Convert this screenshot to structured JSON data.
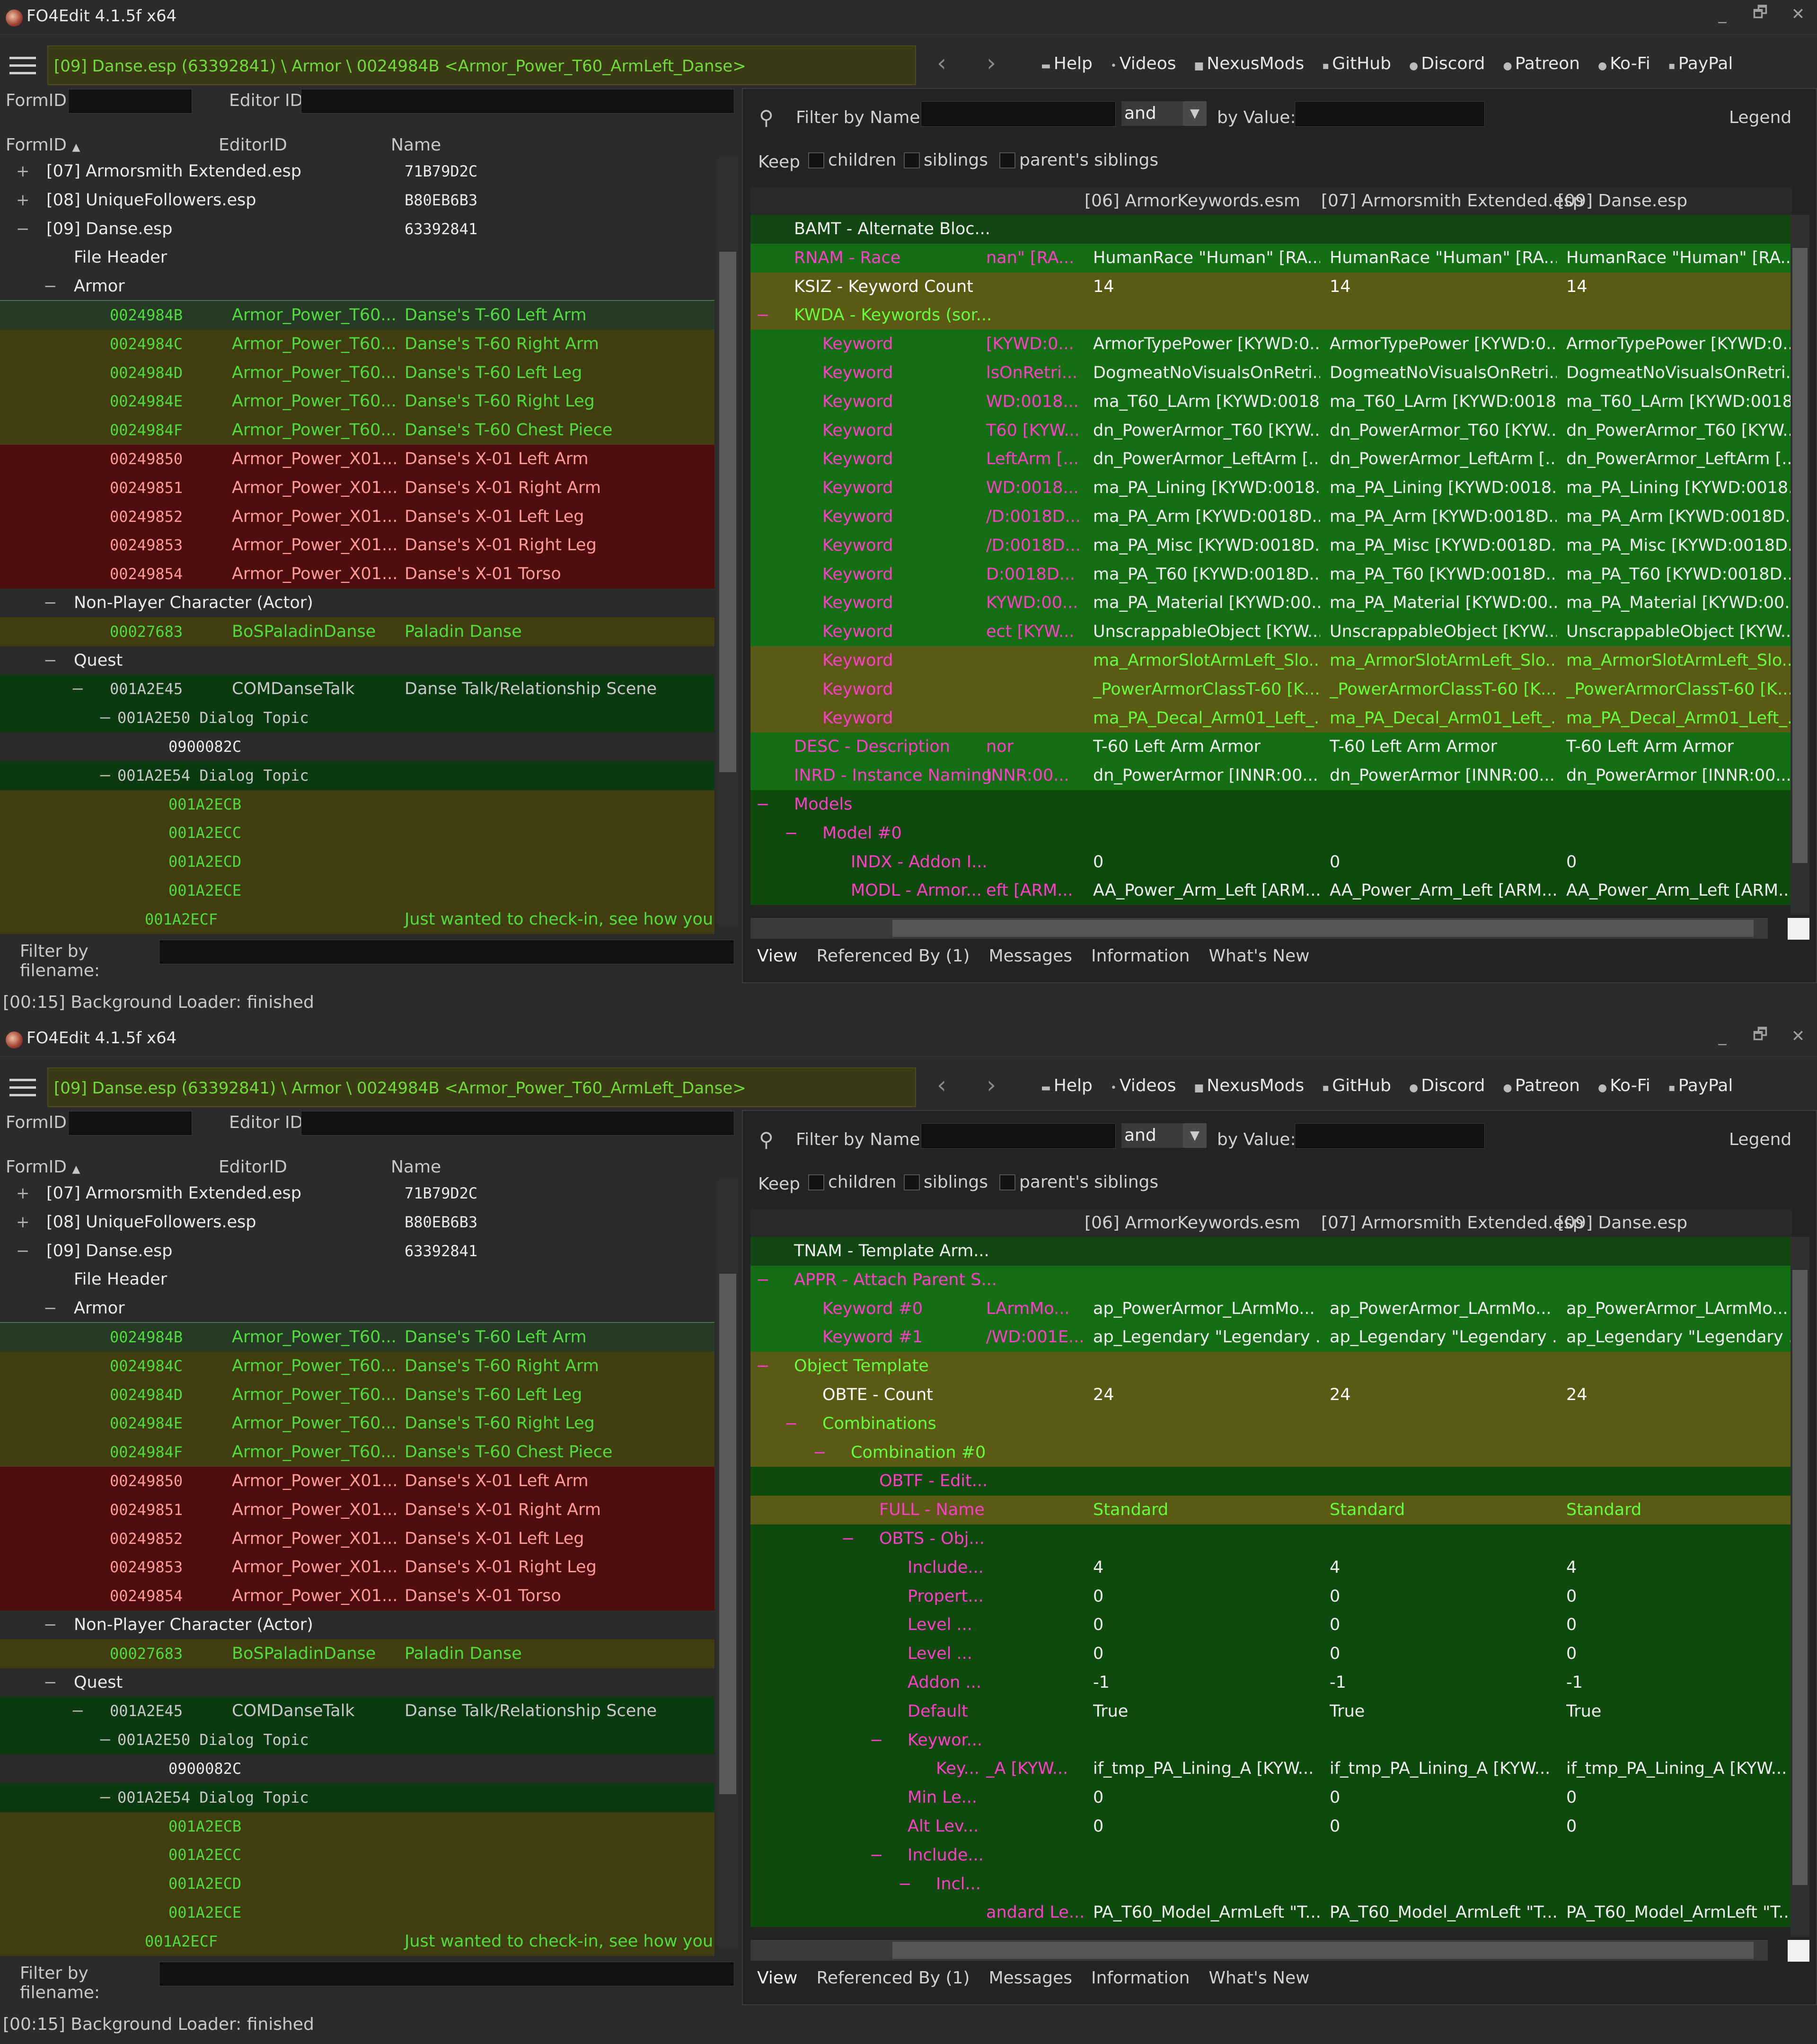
{
  "app_title": "FO4Edit 4.1.5f x64",
  "window_controls": [
    "_",
    "🗗",
    "✕"
  ],
  "path": "[09] Danse.esp (63392841) \\ Armor \\ 0024984B <Armor_Power_T60_ArmLeft_Danse>",
  "nav": {
    "back": "‹",
    "forward": "›"
  },
  "links": [
    {
      "icon": "▬",
      "label": "Help"
    },
    {
      "icon": "•",
      "label": "Videos"
    },
    {
      "icon": "■",
      "label": "NexusMods"
    },
    {
      "icon": "▪",
      "label": "GitHub"
    },
    {
      "icon": "●",
      "label": "Discord"
    },
    {
      "icon": "●",
      "label": "Patreon"
    },
    {
      "icon": "●",
      "label": "Ko-Fi"
    },
    {
      "icon": "▪",
      "label": "PayPal"
    }
  ],
  "formid_label": "FormID",
  "editorid_label": "Editor ID",
  "tree_headers": {
    "formid": "FormID",
    "editorid": "EditorID",
    "name": "Name"
  },
  "tree_rows": [
    {
      "ind": 0,
      "exp": "+",
      "c1": "[07] Armorsmith Extended.esp",
      "c2": "",
      "c3": "71B79D2C",
      "bg": "bg-none",
      "cls": "t-wht",
      "mono3": true
    },
    {
      "ind": 0,
      "exp": "+",
      "c1": "[08] UniqueFollowers.esp",
      "c2": "",
      "c3": "B80EB6B3",
      "bg": "bg-none",
      "cls": "t-wht",
      "mono3": true
    },
    {
      "ind": 0,
      "exp": "−",
      "c1": "[09] Danse.esp",
      "c2": "",
      "c3": "63392841",
      "bg": "bg-none",
      "cls": "t-wht",
      "mono3": true
    },
    {
      "ind": 1,
      "exp": "",
      "c1": "File Header",
      "c2": "",
      "c3": "",
      "bg": "bg-none",
      "cls": "t-wht"
    },
    {
      "ind": 1,
      "exp": "−",
      "c1": "Armor",
      "c2": "",
      "c3": "",
      "bg": "bg-none",
      "cls": "t-wht"
    },
    {
      "ind": 2,
      "exp": "",
      "c1": "0024984B",
      "c2": "Armor_Power_T60...",
      "c3": "Danse's T-60 Left Arm",
      "bg": "bg-sel",
      "cls": "t-grn",
      "mono1": true
    },
    {
      "ind": 2,
      "exp": "",
      "c1": "0024984C",
      "c2": "Armor_Power_T60...",
      "c3": "Danse's T-60 Right Arm",
      "bg": "bg-ylw",
      "cls": "t-grn",
      "mono1": true
    },
    {
      "ind": 2,
      "exp": "",
      "c1": "0024984D",
      "c2": "Armor_Power_T60...",
      "c3": "Danse's T-60 Left Leg",
      "bg": "bg-ylw",
      "cls": "t-grn",
      "mono1": true
    },
    {
      "ind": 2,
      "exp": "",
      "c1": "0024984E",
      "c2": "Armor_Power_T60...",
      "c3": "Danse's T-60 Right Leg",
      "bg": "bg-ylw",
      "cls": "t-grn",
      "mono1": true
    },
    {
      "ind": 2,
      "exp": "",
      "c1": "0024984F",
      "c2": "Armor_Power_T60...",
      "c3": "Danse's T-60 Chest Piece",
      "bg": "bg-ylw",
      "cls": "t-grn",
      "mono1": true
    },
    {
      "ind": 2,
      "exp": "",
      "c1": "00249850",
      "c2": "Armor_Power_X01...",
      "c3": "Danse's X-01 Left Arm",
      "bg": "bg-red",
      "cls": "t-pnk",
      "mono1": true
    },
    {
      "ind": 2,
      "exp": "",
      "c1": "00249851",
      "c2": "Armor_Power_X01...",
      "c3": "Danse's X-01 Right Arm",
      "bg": "bg-red",
      "cls": "t-pnk",
      "mono1": true
    },
    {
      "ind": 2,
      "exp": "",
      "c1": "00249852",
      "c2": "Armor_Power_X01...",
      "c3": "Danse's X-01 Left Leg",
      "bg": "bg-red",
      "cls": "t-pnk",
      "mono1": true
    },
    {
      "ind": 2,
      "exp": "",
      "c1": "00249853",
      "c2": "Armor_Power_X01...",
      "c3": "Danse's X-01 Right Leg",
      "bg": "bg-red",
      "cls": "t-pnk",
      "mono1": true
    },
    {
      "ind": 2,
      "exp": "",
      "c1": "00249854",
      "c2": "Armor_Power_X01...",
      "c3": "Danse's X-01 Torso",
      "bg": "bg-red",
      "cls": "t-pnk",
      "mono1": true
    },
    {
      "ind": 1,
      "exp": "−",
      "c1": "Non-Player Character (Actor)",
      "c2": "",
      "c3": "",
      "bg": "bg-none",
      "cls": "t-wht"
    },
    {
      "ind": 2,
      "exp": "",
      "c1": "00027683",
      "c2": "BoSPaladinDanse",
      "c3": "Paladin Danse",
      "bg": "bg-ylw",
      "cls": "t-grn",
      "mono1": true
    },
    {
      "ind": 1,
      "exp": "−",
      "c1": "Quest",
      "c2": "",
      "c3": "",
      "bg": "bg-none",
      "cls": "t-wht"
    },
    {
      "ind": 2,
      "exp": "−",
      "c1": "001A2E45",
      "c2": "COMDanseTalk",
      "c3": "Danse Talk/Relationship Scene",
      "bg": "bg-grn",
      "cls": "t-gry",
      "mono1": true
    },
    {
      "ind": 3,
      "exp": "−",
      "c1": "001A2E50  Dialog Topic",
      "c2": "",
      "c3": "",
      "bg": "bg-grn",
      "cls": "t-gry",
      "mono1": true
    },
    {
      "ind": 4,
      "exp": "",
      "c1": "0900082C",
      "c2": "",
      "c3": "",
      "bg": "bg-none",
      "cls": "t-wht",
      "mono1": true
    },
    {
      "ind": 3,
      "exp": "−",
      "c1": "001A2E54  Dialog Topic",
      "c2": "",
      "c3": "",
      "bg": "bg-grn",
      "cls": "t-gry",
      "mono1": true
    },
    {
      "ind": 4,
      "exp": "",
      "c1": "001A2ECB",
      "c2": "",
      "c3": "",
      "bg": "bg-ylw",
      "cls": "t-grn",
      "mono1": true
    },
    {
      "ind": 4,
      "exp": "",
      "c1": "001A2ECC",
      "c2": "",
      "c3": "",
      "bg": "bg-ylw",
      "cls": "t-grn",
      "mono1": true
    },
    {
      "ind": 4,
      "exp": "",
      "c1": "001A2ECD",
      "c2": "",
      "c3": "",
      "bg": "bg-ylw",
      "cls": "t-grn",
      "mono1": true
    },
    {
      "ind": 4,
      "exp": "",
      "c1": "001A2ECE",
      "c2": "",
      "c3": "",
      "bg": "bg-ylw",
      "cls": "t-grn",
      "mono1": true
    },
    {
      "ind": 4,
      "exp": "",
      "c1": "001A2ECF",
      "c2": "",
      "c3": "Just wanted to check-in, see how you f...",
      "bg": "bg-ylw",
      "cls": "t-grn",
      "mono1": true
    }
  ],
  "filter_filename_label": "Filter by filename:",
  "status_text": "[00:15] Background Loader: finished",
  "right": {
    "filter_by_name": "Filter by Name:",
    "and": "and",
    "by_value": "by Value:",
    "legend": "Legend",
    "keep": "Keep",
    "children": "children",
    "siblings": "siblings",
    "parent_siblings": "parent's siblings",
    "col_a": "[06] ArmorKeywords.esm",
    "col_b": "[07] Armorsmith Extended.esp",
    "col_c": "[09] Danse.esp",
    "tabs": [
      "View",
      "Referenced By (1)",
      "Messages",
      "Information",
      "What's New"
    ]
  },
  "grid_top": [
    {
      "ind": 0,
      "exp": "",
      "a": "BAMT - Alternate Bloc...",
      "b": "",
      "c": "",
      "d": "",
      "e": "",
      "bg": "bg-hdr",
      "ac": "v-wht",
      "vc": "v-wht"
    },
    {
      "ind": 0,
      "exp": "",
      "a": "RNAM - Race",
      "b": "nan\" [RA...",
      "c": "HumanRace \"Human\" [RA...",
      "d": "HumanRace \"Human\" [RA...",
      "e": "HumanRace \"Human\" [RA...",
      "bg": "bg-lime",
      "ac": "",
      "vc": "v-wht"
    },
    {
      "ind": 0,
      "exp": "",
      "a": "KSIZ - Keyword Count",
      "b": "",
      "c": "14",
      "d": "14",
      "e": "14",
      "bg": "bg-olive",
      "ac": "v-w2",
      "vc": "v-w2"
    },
    {
      "ind": 0,
      "exp": "−",
      "a": "KWDA - Keywords (sor...",
      "b": "",
      "c": "",
      "d": "",
      "e": "",
      "bg": "bg-olive",
      "ac": "v-lim",
      "vc": "v-wht"
    },
    {
      "ind": 1,
      "exp": "",
      "a": "Keyword",
      "b": " [KYWD:0...",
      "c": "ArmorTypePower [KYWD:0...",
      "d": "ArmorTypePower [KYWD:0...",
      "e": "ArmorTypePower [KYWD:0...",
      "bg": "bg-lime",
      "ac": "",
      "vc": "v-wht"
    },
    {
      "ind": 1,
      "exp": "",
      "a": "Keyword",
      "b": "lsOnRetri...",
      "c": "DogmeatNoVisualsOnRetri...",
      "d": "DogmeatNoVisualsOnRetri...",
      "e": "DogmeatNoVisualsOnRetri...",
      "bg": "bg-lime",
      "ac": "",
      "vc": "v-wht"
    },
    {
      "ind": 1,
      "exp": "",
      "a": "Keyword",
      "b": "WD:0018...",
      "c": "ma_T60_LArm [KYWD:0018...",
      "d": "ma_T60_LArm [KYWD:0018...",
      "e": "ma_T60_LArm [KYWD:0018...",
      "bg": "bg-lime",
      "ac": "",
      "vc": "v-wht"
    },
    {
      "ind": 1,
      "exp": "",
      "a": "Keyword",
      "b": "T60 [KYW...",
      "c": "dn_PowerArmor_T60 [KYW...",
      "d": "dn_PowerArmor_T60 [KYW...",
      "e": "dn_PowerArmor_T60 [KYW...",
      "bg": "bg-lime",
      "ac": "",
      "vc": "v-wht"
    },
    {
      "ind": 1,
      "exp": "",
      "a": "Keyword",
      "b": "LeftArm [...",
      "c": "dn_PowerArmor_LeftArm [...",
      "d": "dn_PowerArmor_LeftArm [...",
      "e": "dn_PowerArmor_LeftArm [...",
      "bg": "bg-lime",
      "ac": "",
      "vc": "v-wht"
    },
    {
      "ind": 1,
      "exp": "",
      "a": "Keyword",
      "b": "WD:0018...",
      "c": "ma_PA_Lining [KYWD:0018...",
      "d": "ma_PA_Lining [KYWD:0018...",
      "e": "ma_PA_Lining [KYWD:0018...",
      "bg": "bg-lime",
      "ac": "",
      "vc": "v-wht"
    },
    {
      "ind": 1,
      "exp": "",
      "a": "Keyword",
      "b": "/D:0018D...",
      "c": "ma_PA_Arm [KYWD:0018D...",
      "d": "ma_PA_Arm [KYWD:0018D...",
      "e": "ma_PA_Arm [KYWD:0018D...",
      "bg": "bg-lime",
      "ac": "",
      "vc": "v-wht"
    },
    {
      "ind": 1,
      "exp": "",
      "a": "Keyword",
      "b": "/D:0018D...",
      "c": "ma_PA_Misc [KYWD:0018D...",
      "d": "ma_PA_Misc [KYWD:0018D...",
      "e": "ma_PA_Misc [KYWD:0018D...",
      "bg": "bg-lime",
      "ac": "",
      "vc": "v-wht"
    },
    {
      "ind": 1,
      "exp": "",
      "a": "Keyword",
      "b": "D:0018D...",
      "c": "ma_PA_T60 [KYWD:0018D...",
      "d": "ma_PA_T60 [KYWD:0018D...",
      "e": "ma_PA_T60 [KYWD:0018D...",
      "bg": "bg-lime",
      "ac": "",
      "vc": "v-wht"
    },
    {
      "ind": 1,
      "exp": "",
      "a": "Keyword",
      "b": "KYWD:00...",
      "c": "ma_PA_Material [KYWD:00...",
      "d": "ma_PA_Material [KYWD:00...",
      "e": "ma_PA_Material [KYWD:00...",
      "bg": "bg-lime",
      "ac": "",
      "vc": "v-wht"
    },
    {
      "ind": 1,
      "exp": "",
      "a": "Keyword",
      "b": "ect [KYW...",
      "c": "UnscrappableObject [KYW...",
      "d": "UnscrappableObject [KYW...",
      "e": "UnscrappableObject [KYW...",
      "bg": "bg-lime",
      "ac": "",
      "vc": "v-wht"
    },
    {
      "ind": 1,
      "exp": "",
      "a": "Keyword",
      "b": "",
      "c": "ma_ArmorSlotArmLeft_Slo...",
      "d": "ma_ArmorSlotArmLeft_Slo...",
      "e": "ma_ArmorSlotArmLeft_Slo...",
      "bg": "bg-olive",
      "ac": "",
      "vc": "v-lim"
    },
    {
      "ind": 1,
      "exp": "",
      "a": "Keyword",
      "b": "",
      "c": "_PowerArmorClassT-60 [K...",
      "d": "_PowerArmorClassT-60 [K...",
      "e": "_PowerArmorClassT-60 [K...",
      "bg": "bg-olive",
      "ac": "",
      "vc": "v-lim"
    },
    {
      "ind": 1,
      "exp": "",
      "a": "Keyword",
      "b": "",
      "c": "ma_PA_Decal_Arm01_Left_...",
      "d": "ma_PA_Decal_Arm01_Left_...",
      "e": "ma_PA_Decal_Arm01_Left_...",
      "bg": "bg-olive",
      "ac": "",
      "vc": "v-lim"
    },
    {
      "ind": 0,
      "exp": "",
      "a": "DESC - Description",
      "b": "nor",
      "c": "T-60 Left Arm Armor",
      "d": "T-60 Left Arm Armor",
      "e": "T-60 Left Arm Armor",
      "bg": "bg-lime",
      "ac": "",
      "vc": "v-wht"
    },
    {
      "ind": 0,
      "exp": "",
      "a": "INRD - Instance Naming",
      "b": "INNR:00...",
      "c": "dn_PowerArmor [INNR:00...",
      "d": "dn_PowerArmor [INNR:00...",
      "e": "dn_PowerArmor [INNR:00...",
      "bg": "bg-lime",
      "ac": "",
      "vc": "v-wht"
    },
    {
      "ind": 0,
      "exp": "−",
      "a": "Models",
      "b": "",
      "c": "",
      "d": "",
      "e": "",
      "bg": "bg-dkg",
      "ac": "",
      "vc": "v-wht"
    },
    {
      "ind": 1,
      "exp": "−",
      "a": "Model #0",
      "b": "",
      "c": "",
      "d": "",
      "e": "",
      "bg": "bg-dkg",
      "ac": "",
      "vc": "v-wht"
    },
    {
      "ind": 2,
      "exp": "",
      "a": "INDX - Addon I...",
      "b": "",
      "c": "0",
      "d": "0",
      "e": "0",
      "bg": "bg-dkg",
      "ac": "",
      "vc": "v-wht"
    },
    {
      "ind": 2,
      "exp": "",
      "a": "MODL - Armor...",
      "b": "eft [ARM...",
      "c": "AA_Power_Arm_Left [ARM...",
      "d": "AA_Power_Arm_Left [ARM...",
      "e": "AA_Power_Arm_Left [ARM...",
      "bg": "bg-dkg",
      "ac": "",
      "vc": "v-wht"
    }
  ],
  "grid_bottom": [
    {
      "ind": 0,
      "exp": "",
      "a": "TNAM - Template Arm...",
      "b": "",
      "c": "",
      "d": "",
      "e": "",
      "bg": "bg-hdr",
      "ac": "v-wht",
      "vc": "v-wht"
    },
    {
      "ind": 0,
      "exp": "−",
      "a": "APPR - Attach Parent S...",
      "b": "",
      "c": "",
      "d": "",
      "e": "",
      "bg": "bg-lime",
      "ac": "",
      "vc": "v-wht"
    },
    {
      "ind": 1,
      "exp": "",
      "a": "Keyword #0",
      "b": "LArmMo...",
      "c": "ap_PowerArmor_LArmMo...",
      "d": "ap_PowerArmor_LArmMo...",
      "e": "ap_PowerArmor_LArmMo...",
      "bg": "bg-lime",
      "ac": "",
      "vc": "v-wht"
    },
    {
      "ind": 1,
      "exp": "",
      "a": "Keyword #1",
      "b": "/WD:001E...",
      "c": "ap_Legendary \"Legendary ...",
      "d": "ap_Legendary \"Legendary ...",
      "e": "ap_Legendary \"Legendary ...",
      "bg": "bg-lime",
      "ac": "",
      "vc": "v-wht"
    },
    {
      "ind": 0,
      "exp": "−",
      "a": "Object Template",
      "b": "",
      "c": "",
      "d": "",
      "e": "",
      "bg": "bg-olive",
      "ac": "v-lim",
      "vc": "v-wht"
    },
    {
      "ind": 1,
      "exp": "",
      "a": "OBTE - Count",
      "b": "",
      "c": "24",
      "d": "24",
      "e": "24",
      "bg": "bg-olive",
      "ac": "v-w2",
      "vc": "v-w2"
    },
    {
      "ind": 1,
      "exp": "−",
      "a": "Combinations",
      "b": "",
      "c": "",
      "d": "",
      "e": "",
      "bg": "bg-olive",
      "ac": "v-lim",
      "vc": "v-wht"
    },
    {
      "ind": 2,
      "exp": "−",
      "a": "Combination #0",
      "b": "",
      "c": "",
      "d": "",
      "e": "",
      "bg": "bg-olive",
      "ac": "v-lim",
      "vc": "v-wht"
    },
    {
      "ind": 3,
      "exp": "",
      "a": "OBTF - Edit...",
      "b": "",
      "c": "",
      "d": "",
      "e": "",
      "bg": "bg-dkg",
      "ac": "",
      "vc": "v-wht"
    },
    {
      "ind": 3,
      "exp": "",
      "a": "FULL - Name",
      "b": "",
      "c": "Standard",
      "d": "Standard",
      "e": "Standard",
      "bg": "bg-olive",
      "ac": "",
      "vc": "v-lim"
    },
    {
      "ind": 3,
      "exp": "−",
      "a": "OBTS - Obj...",
      "b": "",
      "c": "",
      "d": "",
      "e": "",
      "bg": "bg-dkg",
      "ac": "",
      "vc": "v-wht"
    },
    {
      "ind": 4,
      "exp": "",
      "a": "Include...",
      "b": "",
      "c": "4",
      "d": "4",
      "e": "4",
      "bg": "bg-dkg",
      "ac": "",
      "vc": "v-wht"
    },
    {
      "ind": 4,
      "exp": "",
      "a": "Propert...",
      "b": "",
      "c": "0",
      "d": "0",
      "e": "0",
      "bg": "bg-dkg",
      "ac": "",
      "vc": "v-wht"
    },
    {
      "ind": 4,
      "exp": "",
      "a": "Level ...",
      "b": "",
      "c": "0",
      "d": "0",
      "e": "0",
      "bg": "bg-dkg",
      "ac": "",
      "vc": "v-wht"
    },
    {
      "ind": 4,
      "exp": "",
      "a": "Level ...",
      "b": "",
      "c": "0",
      "d": "0",
      "e": "0",
      "bg": "bg-dkg",
      "ac": "",
      "vc": "v-wht"
    },
    {
      "ind": 4,
      "exp": "",
      "a": "Addon ...",
      "b": "",
      "c": "-1",
      "d": "-1",
      "e": "-1",
      "bg": "bg-dkg",
      "ac": "",
      "vc": "v-wht"
    },
    {
      "ind": 4,
      "exp": "",
      "a": "Default",
      "b": "",
      "c": "True",
      "d": "True",
      "e": "True",
      "bg": "bg-dkg",
      "ac": "",
      "vc": "v-wht"
    },
    {
      "ind": 4,
      "exp": "−",
      "a": "Keywor...",
      "b": "",
      "c": "",
      "d": "",
      "e": "",
      "bg": "bg-dkg",
      "ac": "",
      "vc": "v-wht"
    },
    {
      "ind": 5,
      "exp": "",
      "a": "Key...",
      "b": "_A [KYW...",
      "c": "if_tmp_PA_Lining_A [KYW...",
      "d": "if_tmp_PA_Lining_A [KYW...",
      "e": "if_tmp_PA_Lining_A [KYW...",
      "bg": "bg-dkg",
      "ac": "",
      "vc": "v-wht"
    },
    {
      "ind": 4,
      "exp": "",
      "a": "Min Le...",
      "b": "",
      "c": "0",
      "d": "0",
      "e": "0",
      "bg": "bg-dkg",
      "ac": "",
      "vc": "v-wht"
    },
    {
      "ind": 4,
      "exp": "",
      "a": "Alt Lev...",
      "b": "",
      "c": "0",
      "d": "0",
      "e": "0",
      "bg": "bg-dkg",
      "ac": "",
      "vc": "v-wht"
    },
    {
      "ind": 4,
      "exp": "−",
      "a": "Include...",
      "b": "",
      "c": "",
      "d": "",
      "e": "",
      "bg": "bg-dkg",
      "ac": "",
      "vc": "v-wht"
    },
    {
      "ind": 5,
      "exp": "−",
      "a": "Incl...",
      "b": "",
      "c": "",
      "d": "",
      "e": "",
      "bg": "bg-dkg",
      "ac": "",
      "vc": "v-wht"
    },
    {
      "ind": 6,
      "exp": "",
      "a": "",
      "b": "andard Le...",
      "c": "PA_T60_Model_ArmLeft \"T...",
      "d": "PA_T60_Model_ArmLeft \"T...",
      "e": "PA_T60_Model_ArmLeft \"T...",
      "bg": "bg-dkg",
      "ac": "",
      "vc": "v-wht"
    }
  ]
}
